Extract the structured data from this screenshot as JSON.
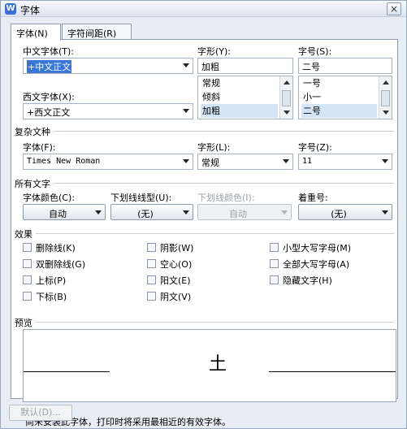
{
  "window": {
    "title": "字体",
    "app_icon_glyph": "W",
    "close_glyph": "×"
  },
  "tabs": [
    {
      "label": "字体(N)",
      "active": true
    },
    {
      "label": "字符间距(R)",
      "active": false
    }
  ],
  "chinese_font": {
    "label": "中文字体(T):",
    "value": "+中文正文"
  },
  "style": {
    "label": "字形(Y):",
    "value": "加粗",
    "options": [
      "常规",
      "倾斜",
      "加粗"
    ],
    "selected_index": 2
  },
  "size": {
    "label": "字号(S):",
    "value": "二号",
    "options": [
      "一号",
      "小一",
      "二号"
    ],
    "selected_index": 2
  },
  "western_font": {
    "label": "西文字体(X):",
    "value": "+西文正文"
  },
  "complex": {
    "section_label": "复杂文种",
    "font_label": "字体(F):",
    "font_value": "Times New Roman",
    "style_label": "字形(L):",
    "style_value": "常规",
    "size_label": "字号(Z):",
    "size_value": "11"
  },
  "all_text": {
    "section_label": "所有文字",
    "color_label": "字体颜色(C):",
    "color_value": "自动",
    "underline_type_label": "下划线线型(U):",
    "underline_type_value": "(无)",
    "underline_color_label": "下划线颜色(I):",
    "underline_color_value": "自动",
    "emphasis_label": "着重号:",
    "emphasis_value": "(无)"
  },
  "effects": {
    "section_label": "效果",
    "col1": [
      "删除线(K)",
      "双删除线(G)",
      "上标(P)",
      "下标(B)"
    ],
    "col2": [
      "阴影(W)",
      "空心(O)",
      "阳文(E)",
      "阴文(V)"
    ],
    "col3": [
      "小型大写字母(M)",
      "全部大写字母(A)",
      "隐藏文字(H)"
    ]
  },
  "preview": {
    "section_label": "预览",
    "sample_text": "土",
    "note": "尚未安装此字体，打印时将采用最相近的有效字体。"
  },
  "buttons": {
    "default_label": "默认(D)..."
  },
  "colors": {
    "selection": "#3875d7",
    "list_selection": "#d5e5f8"
  }
}
